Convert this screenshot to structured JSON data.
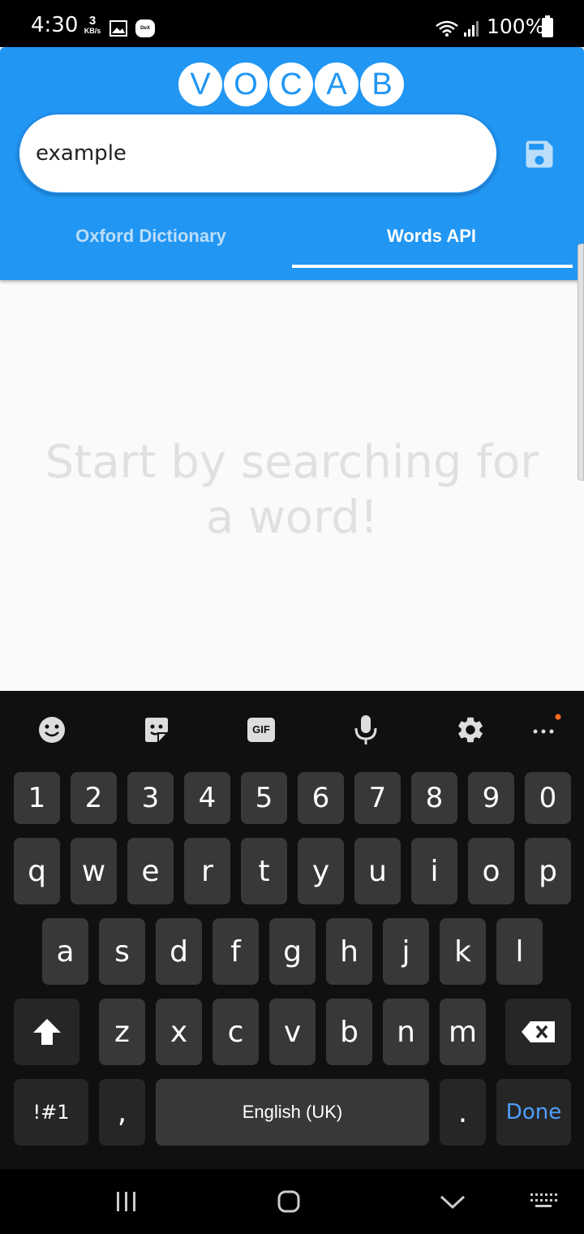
{
  "status_bar": {
    "time": "4:30",
    "net_speed_value": "3",
    "net_speed_unit": "KB/s",
    "dex_label": "DeX",
    "battery": "100%"
  },
  "app": {
    "logo_letters": [
      "V",
      "O",
      "C",
      "A",
      "B"
    ],
    "search": {
      "value": "example"
    },
    "tabs": [
      {
        "label": "Oxford Dictionary",
        "selected": false
      },
      {
        "label": "Words API",
        "selected": true
      }
    ],
    "empty_message": "Start by searching for a word!",
    "colors": {
      "primary": "#2196f3",
      "background": "#fafafa",
      "save_icon": "#bbdefb"
    }
  },
  "keyboard": {
    "toolbar_icons": [
      "emoji-icon",
      "sticker-icon",
      "gif-button",
      "mic-icon",
      "settings-icon",
      "more-icon"
    ],
    "gif_label": "GIF",
    "number_row": [
      "1",
      "2",
      "3",
      "4",
      "5",
      "6",
      "7",
      "8",
      "9",
      "0"
    ],
    "row1": [
      "q",
      "w",
      "e",
      "r",
      "t",
      "y",
      "u",
      "i",
      "o",
      "p"
    ],
    "row2": [
      "a",
      "s",
      "d",
      "f",
      "g",
      "h",
      "j",
      "k",
      "l"
    ],
    "row3": [
      "z",
      "x",
      "c",
      "v",
      "b",
      "n",
      "m"
    ],
    "symbols_label": "!#1",
    "comma_label": ",",
    "space_label": "English (UK)",
    "period_label": ".",
    "done_label": "Done"
  },
  "nav_bar": {
    "buttons": [
      "recent-apps-icon",
      "home-icon",
      "back-icon",
      "keyboard-switch-icon"
    ]
  }
}
